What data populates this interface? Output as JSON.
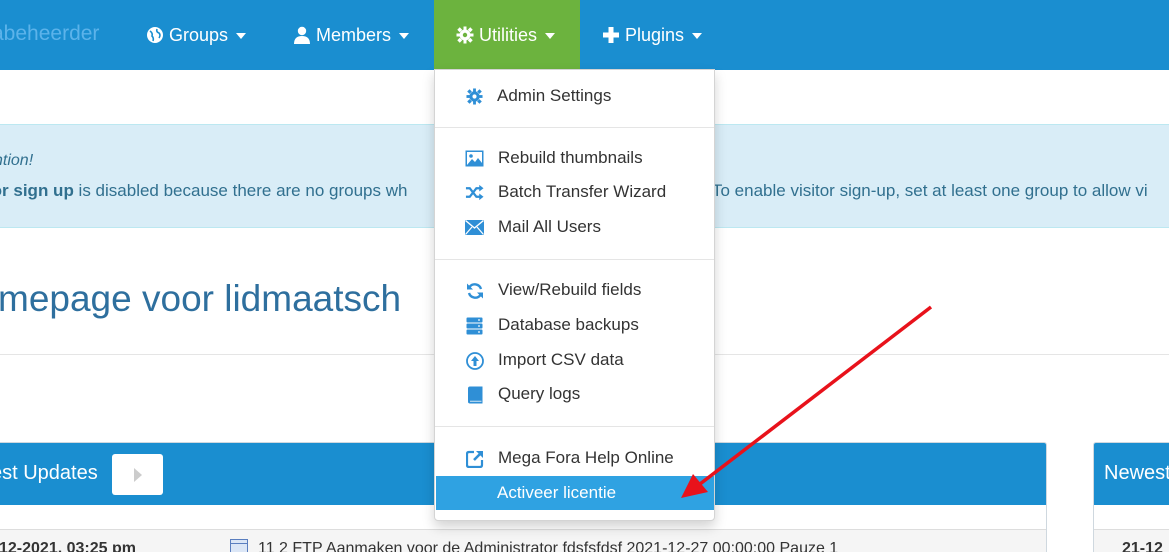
{
  "navbar": {
    "brand": "abeheerder",
    "items": [
      {
        "label": "Groups",
        "icon": "globe-icon"
      },
      {
        "label": "Members",
        "icon": "user-icon"
      },
      {
        "label": "Utilities",
        "icon": "cog-icon"
      },
      {
        "label": "Plugins",
        "icon": "plus-icon"
      }
    ]
  },
  "colors": {
    "navbar": "#1a8ed0",
    "active_nav": "#6cb33e",
    "icon_blue": "#2f8fd6",
    "active_item": "#2fa2e2",
    "annotation_arrow": "#e8121b"
  },
  "alert": {
    "title": "ntion!",
    "bold": "tor sign up",
    "text": " is disabled because there are no groups wh",
    "text_right": "To enable visitor sign-up, set at least one group to allow vi"
  },
  "page": {
    "title": "mepage voor lidmaatsch"
  },
  "dropdown": {
    "items": [
      {
        "label": "Admin Settings",
        "icon": "cog-icon"
      },
      {
        "label": "Rebuild thumbnails",
        "icon": "image-icon"
      },
      {
        "label": "Batch Transfer Wizard",
        "icon": "shuffle-icon"
      },
      {
        "label": "Mail All Users",
        "icon": "envelope-icon"
      },
      {
        "label": "View/Rebuild fields",
        "icon": "refresh-icon"
      },
      {
        "label": "Database backups",
        "icon": "database-icon"
      },
      {
        "label": "Import CSV data",
        "icon": "upload-icon"
      },
      {
        "label": "Query logs",
        "icon": "book-icon"
      },
      {
        "label": "Mega Fora Help Online",
        "icon": "external-link-icon"
      },
      {
        "label": "Activeer licentie",
        "icon": ""
      }
    ]
  },
  "panels": {
    "left": {
      "title": "est Updates",
      "row_date": "12-2021, 03:25 pm",
      "row_text": "11  2  FTP Aanmaken voor de Administrator  fdsfsfdsf  2021-12-27 00:00:00  Pauze  1"
    },
    "right": {
      "title": "Newest",
      "row_date": "21-12"
    }
  }
}
